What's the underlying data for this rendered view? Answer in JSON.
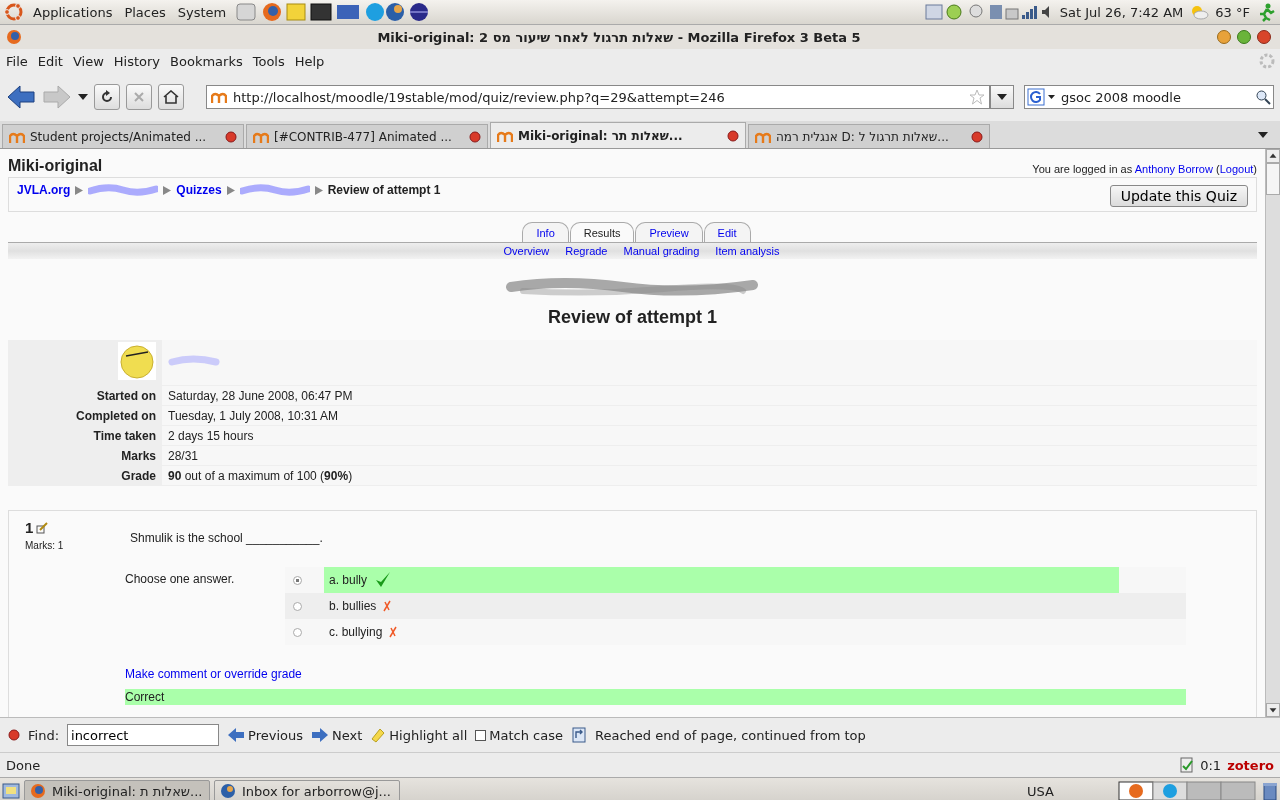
{
  "top_panel": {
    "menus": [
      "Applications",
      "Places",
      "System"
    ],
    "clock": "Sat Jul 26,  7:42 AM",
    "weather": "63 °F"
  },
  "window": {
    "title": "Miki-original: שאלות תרגול לאחר שיעור מס 2 - Mozilla Firefox 3 Beta 5"
  },
  "menu_bar": [
    "File",
    "Edit",
    "View",
    "History",
    "Bookmarks",
    "Tools",
    "Help"
  ],
  "navigation": {
    "url": "http://localhost/moodle/19stable/mod/quiz/review.php?q=29&attempt=246",
    "search": "gsoc 2008 moodle"
  },
  "browser_tabs": [
    {
      "label": "Student projects/Animated ...",
      "selected": false
    },
    {
      "label": "[#CONTRIB-477] Animated ...",
      "selected": false
    },
    {
      "label": "Miki-original: שאלות תר...",
      "selected": true
    },
    {
      "label": "אנגלית רמה D: שאלות תרגול ל...",
      "selected": false
    }
  ],
  "page": {
    "site_title": "Miki-original",
    "login": {
      "prefix": "You are logged in as",
      "user": "Anthony Borrow",
      "open_paren": "(",
      "logout": "Logout",
      "close_paren": ")"
    },
    "breadcrumb": [
      {
        "kind": "link",
        "label": "JVLA.org"
      },
      {
        "kind": "redacted"
      },
      {
        "kind": "link",
        "label": "Quizzes"
      },
      {
        "kind": "redacted"
      },
      {
        "kind": "current",
        "label": "Review of attempt 1"
      }
    ],
    "update_button": "Update this Quiz",
    "tabs": [
      {
        "label": "Info",
        "selected": false
      },
      {
        "label": "Results",
        "selected": true
      },
      {
        "label": "Preview",
        "selected": false
      },
      {
        "label": "Edit",
        "selected": false
      }
    ],
    "subtabs": [
      "Overview",
      "Regrade",
      "Manual grading",
      "Item analysis"
    ],
    "heading": "Review of attempt 1",
    "summary": [
      {
        "label": "Started on",
        "value": "Saturday, 28 June 2008, 06:47 PM"
      },
      {
        "label": "Completed on",
        "value": "Tuesday, 1 July 2008, 10:31 AM"
      },
      {
        "label": "Time taken",
        "value": "2 days 15 hours"
      },
      {
        "label": "Marks",
        "value": "28/31"
      },
      {
        "label": "Grade",
        "value": "**90** out of a maximum of 100 (**90%**)"
      }
    ],
    "question": {
      "number": "1",
      "marks": "Marks: 1",
      "text": "Shmulik is the school ___________.",
      "prompt": "Choose one answer.",
      "answers": [
        {
          "label": "a. bully",
          "selected": true,
          "correct": true
        },
        {
          "label": "b. bullies",
          "selected": false,
          "correct": false
        },
        {
          "label": "c. bullying",
          "selected": false,
          "correct": false
        }
      ],
      "comment_link": "Make comment or override grade",
      "feedback": "Correct"
    }
  },
  "find_bar": {
    "label": "Find:",
    "value": "incorrect",
    "previous": "Previous",
    "next": "Next",
    "highlight": "Highlight all",
    "match_case": {
      "label": "Match case",
      "checked": false
    },
    "status": "Reached end of page, continued from top"
  },
  "status_bar": {
    "text": "Done",
    "counter": "0:1",
    "addon": "zotero"
  },
  "taskbar": {
    "windows": [
      {
        "label": "Miki-original: שאלות ת...",
        "selected": true
      },
      {
        "label": "Inbox for arborrow@j...",
        "selected": false
      }
    ],
    "keyboard": "USA"
  }
}
